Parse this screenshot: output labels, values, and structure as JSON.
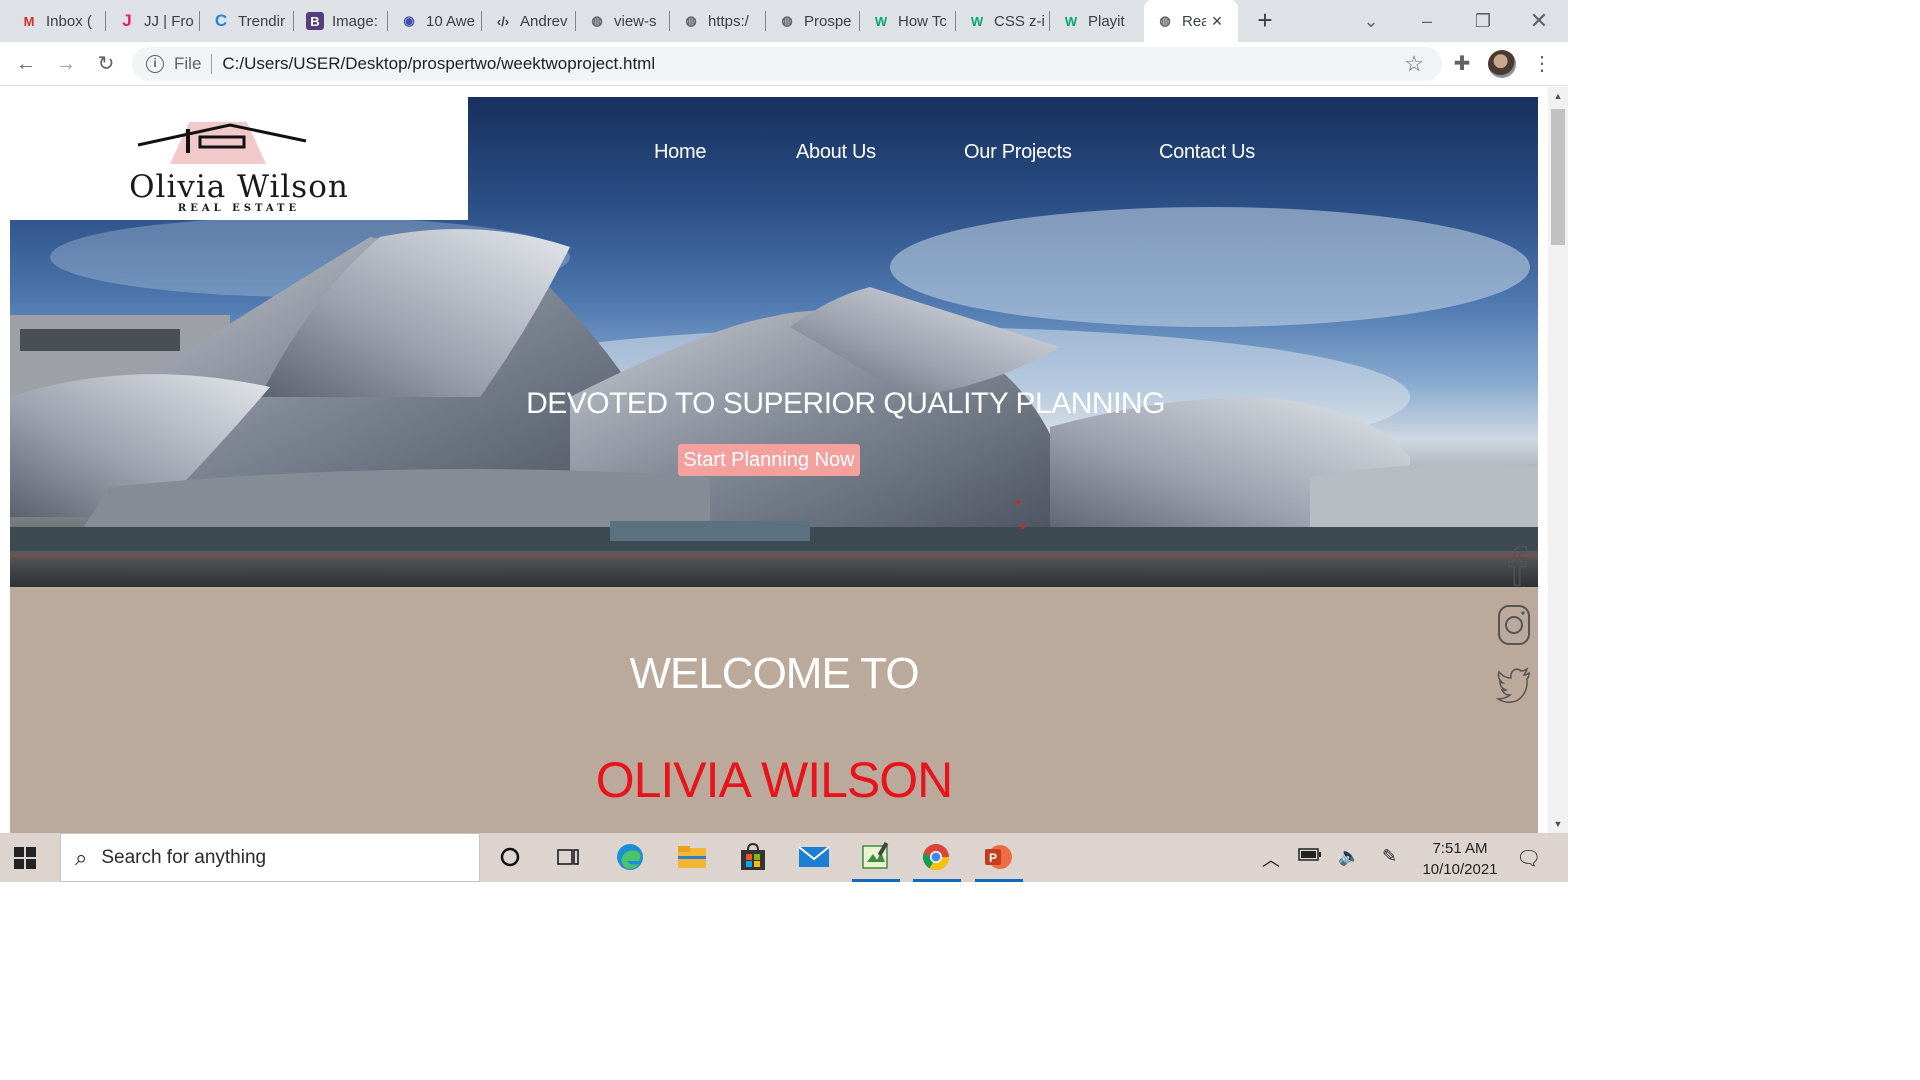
{
  "browser": {
    "tabs": [
      {
        "title": "Inbox (",
        "icon": "gmail-icon",
        "color": "#d93025"
      },
      {
        "title": "JJ | Fro",
        "icon": "j-logo-icon",
        "color": "#e91e63"
      },
      {
        "title": "Trendir",
        "icon": "c-logo-icon",
        "color": "#1e88e5"
      },
      {
        "title": "Image:",
        "icon": "bootstrap-icon",
        "color": "#563d7c"
      },
      {
        "title": "10 Awe",
        "icon": "eye-icon",
        "color": "#3f51b5"
      },
      {
        "title": "Andrev",
        "icon": "code-icon",
        "color": "#3c4043"
      },
      {
        "title": "view-s",
        "icon": "globe-icon",
        "color": "#5f6368"
      },
      {
        "title": "https:/",
        "icon": "globe-icon",
        "color": "#5f6368"
      },
      {
        "title": "Prospe",
        "icon": "globe-icon",
        "color": "#5f6368"
      },
      {
        "title": "How Tc",
        "icon": "w3schools-icon",
        "color": "#04aa6d"
      },
      {
        "title": "CSS z-i",
        "icon": "w3schools-icon",
        "color": "#04aa6d"
      },
      {
        "title": "Playit",
        "icon": "w3schools-icon",
        "color": "#04aa6d"
      },
      {
        "title": "Rea",
        "icon": "globe-icon",
        "color": "#5f6368",
        "active": true
      }
    ],
    "address": {
      "scheme": "File",
      "url": "C:/Users/USER/Desktop/prospertwo/weektwoproject.html"
    }
  },
  "page": {
    "logo": {
      "name": "Olivia Wilson",
      "tagline": "REAL ESTATE"
    },
    "nav": [
      "Home",
      "About Us",
      "Our Projects",
      "Contact Us"
    ],
    "hero": {
      "title": "DEVOTED TO SUPERIOR QUALITY PLANNING",
      "cta": "Start Planning Now"
    },
    "social": [
      "facebook-icon",
      "instagram-icon",
      "twitter-icon"
    ],
    "welcome": {
      "line1": "WELCOME TO",
      "line2": "OLIVIA WILSON"
    },
    "colors": {
      "accent": "#e8131b",
      "button": "#f4a09f",
      "section_bg": "#bbaa9b"
    }
  },
  "taskbar": {
    "search_placeholder": "Search for anything",
    "time": "7:51 AM",
    "date": "10/10/2021"
  }
}
